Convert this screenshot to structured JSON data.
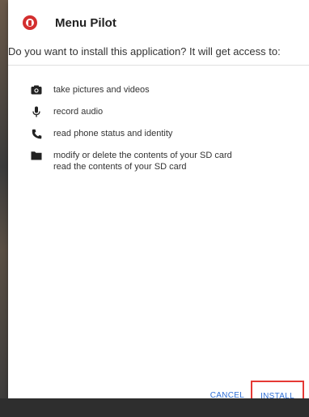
{
  "dialog": {
    "app_name": "Menu Pilot",
    "question": "Do you want to install this application? It will get access to:",
    "permissions": [
      {
        "icon": "camera-icon",
        "label": "take pictures and videos"
      },
      {
        "icon": "microphone-icon",
        "label": "record audio"
      },
      {
        "icon": "phone-icon",
        "label": "read phone status and identity"
      },
      {
        "icon": "folder-icon",
        "label": "modify or delete the contents of your SD card",
        "sub_label": "read the contents of your SD card"
      }
    ],
    "cancel_label": "CANCEL",
    "install_label": "INSTALL"
  },
  "colors": {
    "accent": "#2f6fd6",
    "brand": "#d32f2f",
    "highlight_box": "#e53935"
  }
}
